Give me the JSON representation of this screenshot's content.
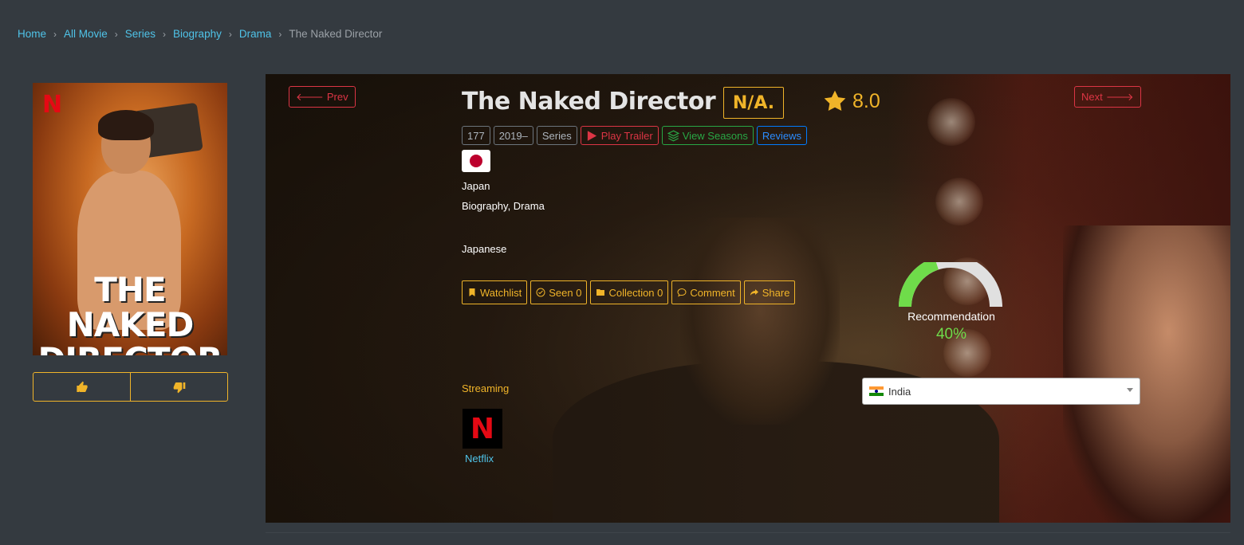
{
  "breadcrumb": {
    "items": [
      "Home",
      "All Movie",
      "Series",
      "Biography",
      "Drama"
    ],
    "current": "The Naked Director"
  },
  "poster": {
    "logo_letter": "N",
    "title_line1": "THE NAKED",
    "title_line2": "DIRECTOR"
  },
  "vote": {
    "like_icon": "thumbs-up-icon",
    "dislike_icon": "thumbs-down-icon"
  },
  "nav": {
    "prev_label": "Prev",
    "next_label": "Next"
  },
  "movie": {
    "title": "The Naked Director",
    "certification": "N/A.",
    "rating": "8.0",
    "tags": {
      "id": "177",
      "year": "2019–",
      "type": "Series",
      "trailer": "Play Trailer",
      "seasons": "View Seasons",
      "reviews": "Reviews"
    },
    "country": "Japan",
    "genres": "Biography, Drama",
    "language": "Japanese"
  },
  "actions": {
    "watchlist": "Watchlist",
    "seen": "Seen 0",
    "collection": "Collection 0",
    "comment": "Comment",
    "share": "Share"
  },
  "recommendation": {
    "label": "Recommendation",
    "value_text": "40%",
    "value": 40,
    "color": "#6fdc4a"
  },
  "streaming": {
    "label": "Streaming",
    "providers": [
      {
        "name": "Netflix",
        "logo_letter": "N"
      }
    ]
  },
  "country_select": {
    "selected": "India"
  },
  "colors": {
    "accent": "#f0b429",
    "link": "#4fc3e8",
    "danger": "#dc3545",
    "success": "#28a745",
    "primary": "#007bff",
    "background": "#343a40"
  }
}
